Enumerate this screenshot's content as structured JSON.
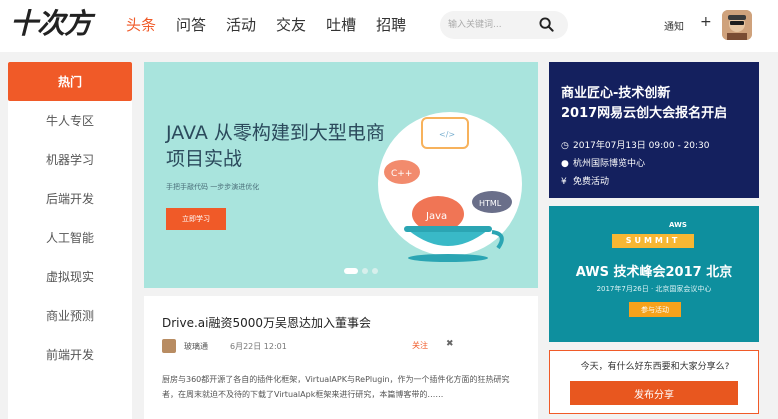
{
  "header": {
    "logo": "十次方",
    "nav": [
      "头条",
      "问答",
      "活动",
      "交友",
      "吐槽",
      "招聘"
    ],
    "search_placeholder": "输入关键词...",
    "notify": "通知",
    "plus": "+"
  },
  "sidebar": {
    "items": [
      "热门",
      "牛人专区",
      "机器学习",
      "后端开发",
      "人工智能",
      "虚拟现实",
      "商业预测",
      "前端开发"
    ]
  },
  "banner": {
    "title": "JAVA 从零构建到大型电商项目实战",
    "subtitle": "手把手敲代码 一步步演进优化",
    "button": "立即学习",
    "tags": {
      "cpp": "C++",
      "html": "HTML",
      "java": "Java",
      "code": "</>"
    }
  },
  "article": {
    "title": "Drive.ai融资5000万吴恩达加入董事会",
    "author": "玻璃通",
    "date": "6月22日 12:01",
    "follow": "关注",
    "close": "✖",
    "excerpt": "厨房与360都开源了各自的插件化框架，VirtualAPK与RePlugin，作为一个插件化方面的狂热研究者，在周末就迫不及待的下载了VirtualApk框架来进行研究，本篇博客带的……"
  },
  "ad1": {
    "title1": "商业匠心-技术创新",
    "title2": "2017网易云创大会报名开启",
    "time": "2017年07月13日 09:00 - 20:30",
    "place": "杭州国际博览中心",
    "fee": "免费活动"
  },
  "ad2": {
    "brand": "AWS",
    "summit": "SUMMIT",
    "title": "AWS 技术峰会2017 北京",
    "sub": "2017年7月26日 · 北京国家会议中心",
    "button": "参与活动"
  },
  "share": {
    "prompt": "今天，有什么好东西要和大家分享么?",
    "button": "发布分享"
  }
}
